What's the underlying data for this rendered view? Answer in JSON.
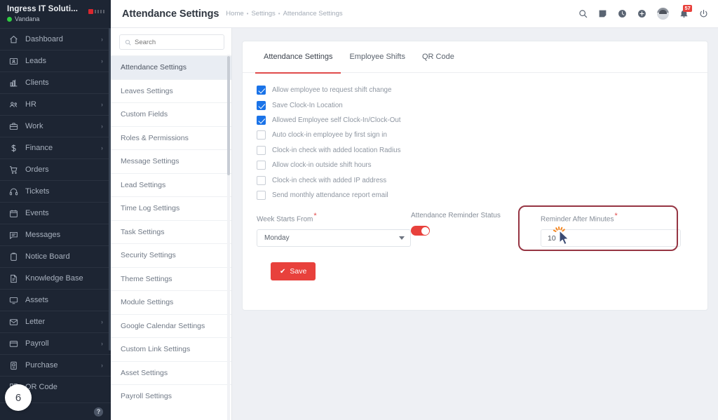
{
  "sidebar": {
    "brand_name": "Ingress IT Soluti...",
    "user_name": "Vandana",
    "items": [
      {
        "label": "Dashboard",
        "icon": "home-icon",
        "caret": "›"
      },
      {
        "label": "Leads",
        "icon": "leads-icon",
        "caret": "›"
      },
      {
        "label": "Clients",
        "icon": "clients-icon",
        "caret": ""
      },
      {
        "label": "HR",
        "icon": "hr-icon",
        "caret": "›"
      },
      {
        "label": "Work",
        "icon": "work-icon",
        "caret": "›"
      },
      {
        "label": "Finance",
        "icon": "finance-icon",
        "caret": "›"
      },
      {
        "label": "Orders",
        "icon": "orders-icon",
        "caret": ""
      },
      {
        "label": "Tickets",
        "icon": "tickets-icon",
        "caret": ""
      },
      {
        "label": "Events",
        "icon": "events-icon",
        "caret": ""
      },
      {
        "label": "Messages",
        "icon": "messages-icon",
        "caret": ""
      },
      {
        "label": "Notice Board",
        "icon": "notice-board-icon",
        "caret": ""
      },
      {
        "label": "Knowledge Base",
        "icon": "knowledge-base-icon",
        "caret": ""
      },
      {
        "label": "Assets",
        "icon": "assets-icon",
        "caret": ""
      },
      {
        "label": "Letter",
        "icon": "letter-icon",
        "caret": "›"
      },
      {
        "label": "Payroll",
        "icon": "payroll-icon",
        "caret": "›"
      },
      {
        "label": "Purchase",
        "icon": "purchase-icon",
        "caret": "›"
      },
      {
        "label": "QR Code",
        "icon": "qr-code-icon",
        "caret": ""
      }
    ],
    "help_label": "?",
    "step_badge": "6"
  },
  "topbar": {
    "title": "Attendance Settings",
    "breadcrumb": [
      "Home",
      "Settings",
      "Attendance Settings"
    ],
    "separator": "•",
    "icons": [
      "search-icon",
      "note-icon",
      "clock-icon",
      "plus-circle-icon",
      "avatar",
      "bell-icon",
      "power-icon"
    ],
    "notification_count": "57"
  },
  "settings_panel": {
    "search_placeholder": "Search",
    "search_value": "",
    "items": [
      "Attendance Settings",
      "Leaves Settings",
      "Custom Fields",
      "Roles & Permissions",
      "Message Settings",
      "Lead Settings",
      "Time Log Settings",
      "Task Settings",
      "Security Settings",
      "Theme Settings",
      "Module Settings",
      "Google Calendar Settings",
      "Custom Link Settings",
      "Asset Settings",
      "Payroll Settings"
    ],
    "active_index": 0
  },
  "main": {
    "tabs": [
      {
        "label": "Attendance Settings",
        "active": true
      },
      {
        "label": "Employee Shifts",
        "active": false
      },
      {
        "label": "QR Code",
        "active": false
      }
    ],
    "checkboxes": [
      {
        "label": "Allow employee to request shift change",
        "checked": true
      },
      {
        "label": "Save Clock-In Location",
        "checked": true
      },
      {
        "label": "Allowed Employee self Clock-In/Clock-Out",
        "checked": true
      },
      {
        "label": "Auto clock-in employee by first sign in",
        "checked": false
      },
      {
        "label": "Clock-in check with added location Radius",
        "checked": false
      },
      {
        "label": "Allow clock-in outside shift hours",
        "checked": false
      },
      {
        "label": "Clock-in check with added IP address",
        "checked": false
      },
      {
        "label": "Send monthly attendance report email",
        "checked": false
      }
    ],
    "week_starts_from": {
      "label": "Week Starts From",
      "required": "*",
      "value": "Monday"
    },
    "reminder_status": {
      "label": "Attendance Reminder Status",
      "enabled": true
    },
    "reminder_after_minutes": {
      "label": "Reminder After Minutes",
      "required": "*",
      "value": "10"
    },
    "save_button": {
      "label": "Save",
      "icon": "check-icon"
    }
  },
  "colors": {
    "accent_red": "#e8413c",
    "checkbox_blue": "#1a73e8",
    "sidebar_bg": "#1d2533",
    "highlight_border": "#963543",
    "cursor_burst": "#f5861f"
  }
}
